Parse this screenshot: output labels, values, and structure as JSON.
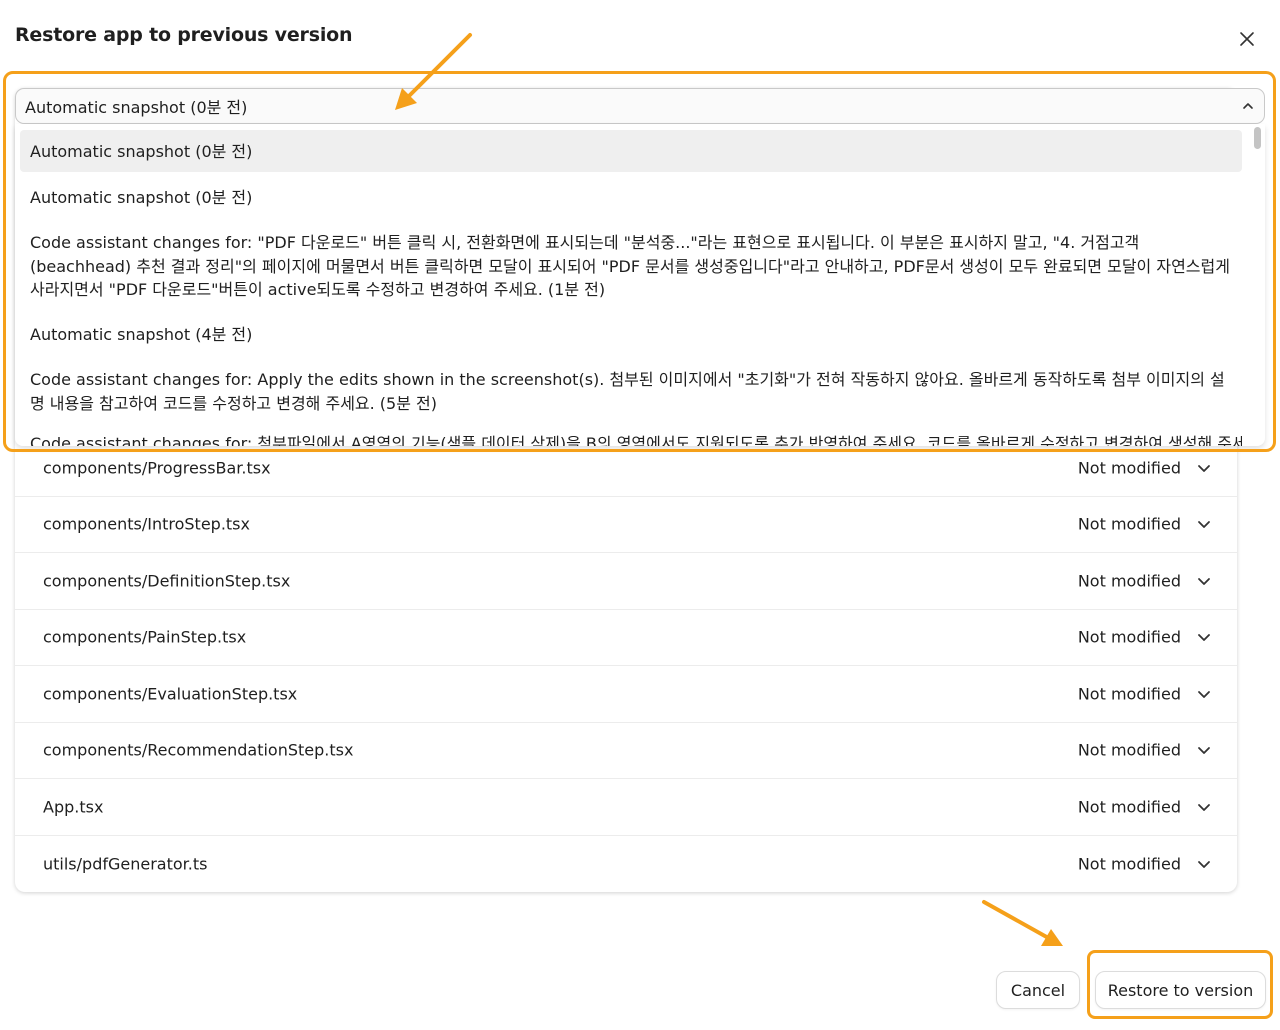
{
  "dialog": {
    "title": "Restore app to previous version",
    "close_icon": "close-icon"
  },
  "select": {
    "value": "Automatic snapshot (0분 전)",
    "expanded": true,
    "options": [
      {
        "label": "Automatic snapshot (0분 전)",
        "selected": true
      },
      {
        "label": "Automatic snapshot (0분 전)",
        "selected": false
      },
      {
        "label": "Code assistant changes for: \"PDF 다운로드\" 버튼 클릭 시, 전환화면에 표시되는데 \"분석중...\"라는 표현으로 표시됩니다. 이 부분은 표시하지 말고, \"4. 거점고객(beachhead) 추천 결과 정리\"의 페이지에 머물면서 버튼 클릭하면 모달이 표시되어 \"PDF 문서를 생성중입니다\"라고 안내하고, PDF문서 생성이 모두 완료되면 모달이 자연스럽게 사라지면서 \"PDF 다운로드\"버튼이 active되도록 수정하고 변경하여 주세요. (1분 전)",
        "selected": false
      },
      {
        "label": "Automatic snapshot (4분 전)",
        "selected": false
      },
      {
        "label": "Code assistant changes for: Apply the edits shown in the screenshot(s). 첨부된 이미지에서 \"초기화\"가 전혀 작동하지 않아요. 올바르게 동작하도록 첨부 이미지의 설명 내용을 참고하여 코드를 수정하고 변경해 주세요. (5분 전)",
        "selected": false
      },
      {
        "label": "Code assistant changes for: 첨부파일에서 A영역의 기능(샘플 데이터 삭제)을 B의 영역에서도 지원되도록 추가 반영하여 주세요. 코드를 올바르게 수정하고 변경하여 생성해 주세요.",
        "selected": false
      }
    ]
  },
  "files": [
    {
      "name": "components/ProgressBar.tsx",
      "status": "Not modified"
    },
    {
      "name": "components/IntroStep.tsx",
      "status": "Not modified"
    },
    {
      "name": "components/DefinitionStep.tsx",
      "status": "Not modified"
    },
    {
      "name": "components/PainStep.tsx",
      "status": "Not modified"
    },
    {
      "name": "components/EvaluationStep.tsx",
      "status": "Not modified"
    },
    {
      "name": "components/RecommendationStep.tsx",
      "status": "Not modified"
    },
    {
      "name": "App.tsx",
      "status": "Not modified"
    },
    {
      "name": "utils/pdfGenerator.ts",
      "status": "Not modified"
    }
  ],
  "footer": {
    "cancel_label": "Cancel",
    "restore_label": "Restore to version"
  },
  "colors": {
    "annotation": "#f5a01a",
    "selected_option_bg": "#efefef"
  }
}
